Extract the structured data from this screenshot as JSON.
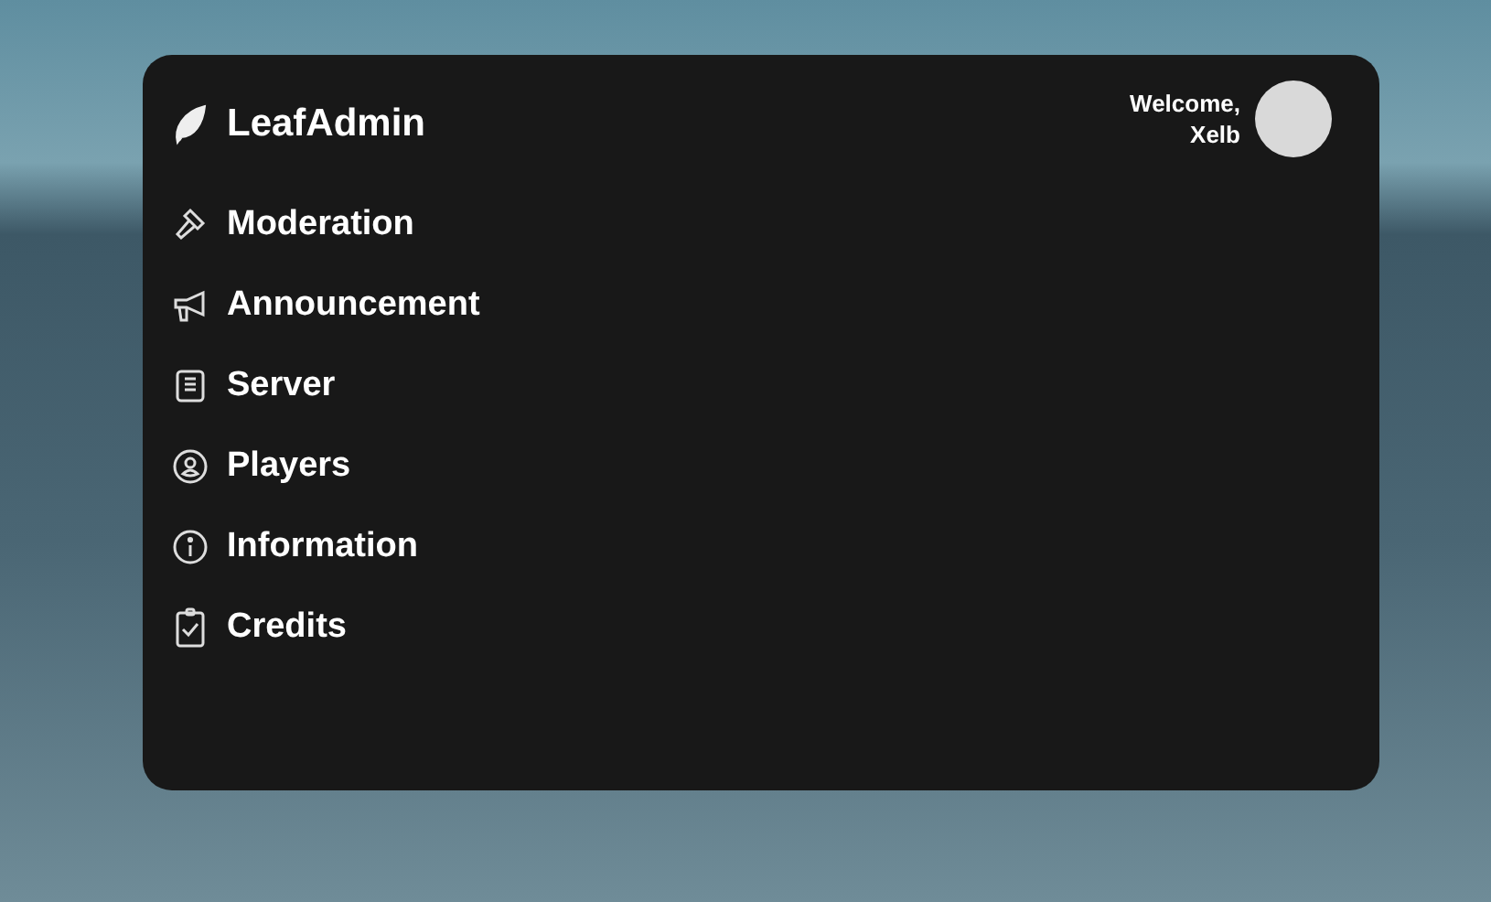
{
  "app": {
    "title": "LeafAdmin"
  },
  "user": {
    "greeting": "Welcome,",
    "name": "Xelb"
  },
  "menu": [
    {
      "label": "Moderation"
    },
    {
      "label": "Announcement"
    },
    {
      "label": "Server"
    },
    {
      "label": "Players"
    },
    {
      "label": "Information"
    },
    {
      "label": "Credits"
    }
  ]
}
